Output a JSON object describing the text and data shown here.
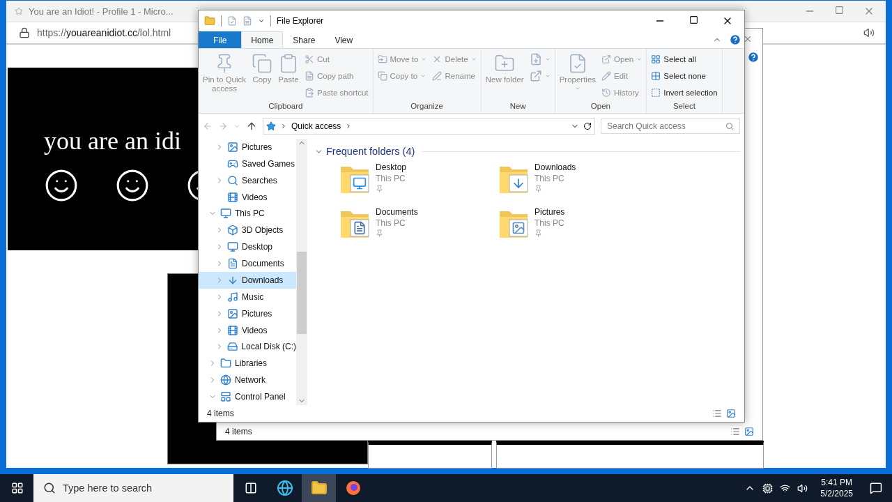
{
  "browser": {
    "tab_title": "You are an Idiot! - Profile 1 - Micro...",
    "url_scheme": "https://",
    "url_host": "youareanidiot.cc",
    "url_path": "/lol.html",
    "heading": "you are an idi"
  },
  "background_explorer": {
    "status": "4 items"
  },
  "explorer": {
    "title": "File Explorer",
    "tabs": [
      {
        "label": "File",
        "selected": false,
        "kind": "file"
      },
      {
        "label": "Home",
        "selected": true,
        "kind": "tab"
      },
      {
        "label": "Share",
        "selected": false,
        "kind": "tab"
      },
      {
        "label": "View",
        "selected": false,
        "kind": "tab"
      }
    ],
    "ribbon_groups": [
      {
        "label": "Clipboard",
        "columns": [
          [
            {
              "label": "Pin to Quick access",
              "kind": "large",
              "disabled": true
            }
          ],
          [
            {
              "label": "Copy",
              "kind": "large",
              "disabled": true
            }
          ],
          [
            {
              "label": "Paste",
              "kind": "large",
              "disabled": true
            }
          ],
          [
            {
              "label": "Cut",
              "kind": "small",
              "disabled": true
            },
            {
              "label": "Copy path",
              "kind": "small",
              "disabled": true
            },
            {
              "label": "Paste shortcut",
              "kind": "small",
              "disabled": true
            }
          ]
        ]
      },
      {
        "label": "Organize",
        "columns": [
          [
            {
              "label": "Move to",
              "kind": "small",
              "disabled": true,
              "dropdown": true
            },
            {
              "label": "Copy to",
              "kind": "small",
              "disabled": true,
              "dropdown": true
            }
          ],
          [
            {
              "label": "Delete",
              "kind": "small",
              "disabled": true,
              "dropdown": true
            },
            {
              "label": "Rename",
              "kind": "small",
              "disabled": true
            }
          ]
        ]
      },
      {
        "label": "New",
        "columns": [
          [
            {
              "label": "New folder",
              "kind": "large",
              "disabled": true
            }
          ],
          [
            {
              "kind": "icon",
              "disabled": true,
              "dropdown": true
            },
            {
              "kind": "icon",
              "disabled": true,
              "dropdown": true
            }
          ]
        ]
      },
      {
        "label": "Open",
        "columns": [
          [
            {
              "label": "Properties",
              "kind": "large",
              "disabled": true,
              "dropdown": true
            }
          ],
          [
            {
              "label": "Open",
              "kind": "small",
              "disabled": true,
              "dropdown": true
            },
            {
              "label": "Edit",
              "kind": "small",
              "disabled": true
            },
            {
              "label": "History",
              "kind": "small",
              "disabled": true
            }
          ]
        ]
      },
      {
        "label": "Select",
        "columns": [
          [
            {
              "label": "Select all",
              "kind": "small",
              "disabled": false
            },
            {
              "label": "Select none",
              "kind": "small",
              "disabled": false
            },
            {
              "label": "Invert selection",
              "kind": "small",
              "disabled": false
            }
          ]
        ]
      }
    ],
    "breadcrumb": "Quick access",
    "search": {
      "placeholder": "Search Quick access"
    },
    "tree_partial_children": [
      {
        "label": "Pictures",
        "expandable": true,
        "expanded": false,
        "selected": false
      },
      {
        "label": "Saved Games",
        "expandable": false,
        "selected": false
      },
      {
        "label": "Searches",
        "expandable": true,
        "expanded": false,
        "selected": false
      },
      {
        "label": "Videos",
        "expandable": false,
        "selected": false
      }
    ],
    "tree": [
      {
        "label": "This PC",
        "expandable": true,
        "expanded": true,
        "selected": false,
        "children": [
          {
            "label": "3D Objects",
            "expandable": true,
            "expanded": false,
            "selected": false
          },
          {
            "label": "Desktop",
            "expandable": true,
            "expanded": false,
            "selected": false
          },
          {
            "label": "Documents",
            "expandable": true,
            "expanded": false,
            "selected": false
          },
          {
            "label": "Downloads",
            "expandable": true,
            "expanded": false,
            "selected": true
          },
          {
            "label": "Music",
            "expandable": true,
            "expanded": false,
            "selected": false
          },
          {
            "label": "Pictures",
            "expandable": true,
            "expanded": false,
            "selected": false
          },
          {
            "label": "Videos",
            "expandable": true,
            "expanded": false,
            "selected": false
          },
          {
            "label": "Local Disk (C:)",
            "expandable": true,
            "expanded": false,
            "selected": false
          }
        ]
      },
      {
        "label": "Libraries",
        "expandable": true,
        "expanded": false,
        "selected": false
      },
      {
        "label": "Network",
        "expandable": true,
        "expanded": false,
        "selected": false
      },
      {
        "label": "Control Panel",
        "expandable": true,
        "expanded": true,
        "selected": false
      }
    ],
    "section": {
      "title": "Frequent folders (4)",
      "expanded": true
    },
    "folders": [
      {
        "name": "Desktop",
        "location": "This PC",
        "pinned": true
      },
      {
        "name": "Downloads",
        "location": "This PC",
        "pinned": true
      },
      {
        "name": "Documents",
        "location": "This PC",
        "pinned": true
      },
      {
        "name": "Pictures",
        "location": "This PC",
        "pinned": true
      }
    ],
    "status": "4 items"
  },
  "taskbar": {
    "search_placeholder": "Type here to search",
    "time": "5:41 PM",
    "date": "5/2/2025"
  }
}
